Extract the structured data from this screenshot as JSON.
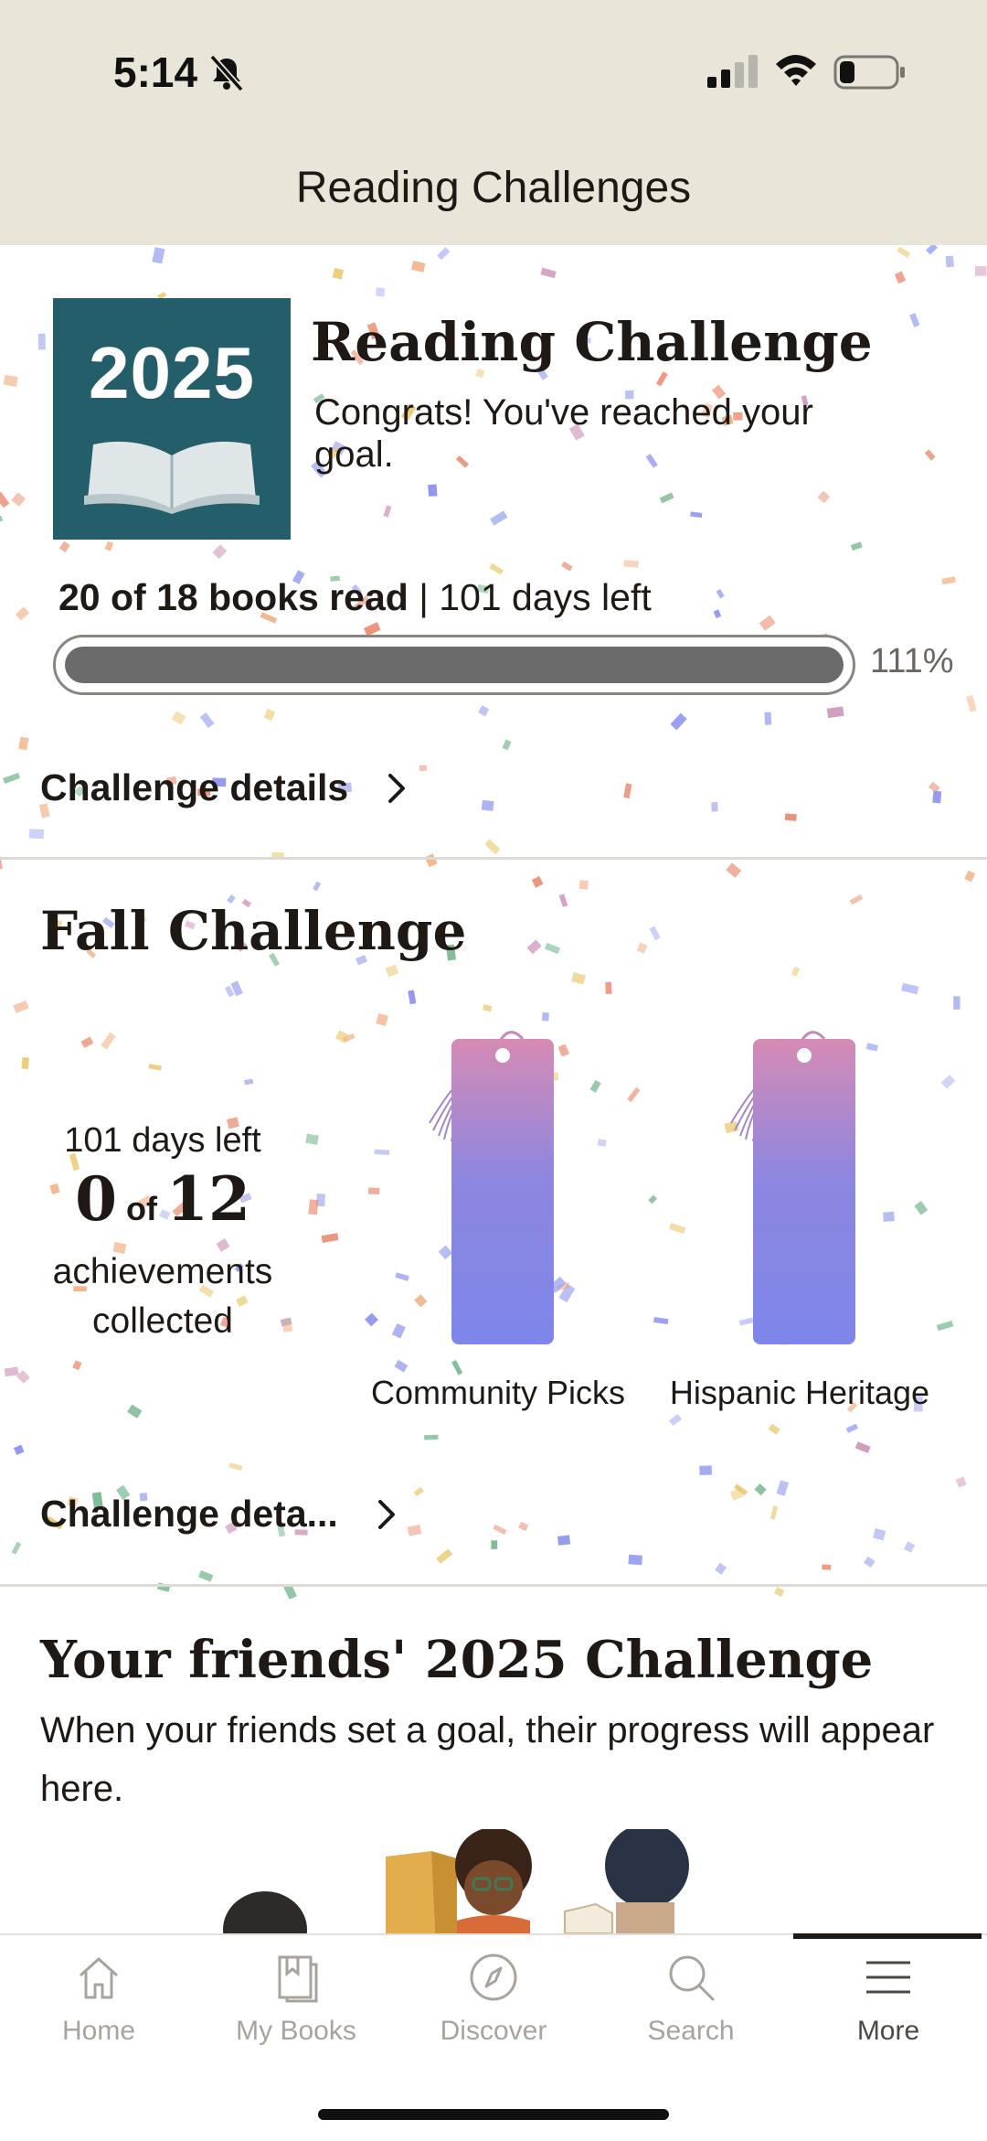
{
  "status_bar": {
    "time": "5:14"
  },
  "header": {
    "title": "Reading Challenges"
  },
  "reading_challenge": {
    "cover_year": "2025",
    "title": "Reading Challenge",
    "subtitle": "Congrats! You've reached your goal.",
    "books_read_text": "20 of 18 books read",
    "days_left_text": " | 101 days left",
    "progress_percent_label": "111%",
    "progress_fraction": 1.0,
    "details_label": "Challenge details"
  },
  "fall_challenge": {
    "title": "Fall Challenge",
    "days_left": "101 days left",
    "achievements_current": "0",
    "achievements_of": "of",
    "achievements_total": "12",
    "achievements_label": "achievements collected",
    "bookmarks": [
      {
        "label": "Community Picks"
      },
      {
        "label": "Hispanic Heritage"
      }
    ],
    "details_label": "Challenge deta..."
  },
  "friends": {
    "title": "Your friends' 2025 Challenge",
    "description": "When your friends set a goal, their progress will appear here."
  },
  "bottom_nav": {
    "items": [
      {
        "label": "Home",
        "icon": "home-icon"
      },
      {
        "label": "My Books",
        "icon": "my-books-icon"
      },
      {
        "label": "Discover",
        "icon": "compass-icon"
      },
      {
        "label": "Search",
        "icon": "search-icon"
      },
      {
        "label": "More",
        "icon": "menu-icon"
      }
    ],
    "active": "More"
  },
  "colors": {
    "header_bg": "#e9e6d9",
    "cover_bg": "#245e6b",
    "progress_fill": "#6b6b6b",
    "bookmark_top": "#d68bb5",
    "bookmark_bottom": "#7e86ea"
  }
}
